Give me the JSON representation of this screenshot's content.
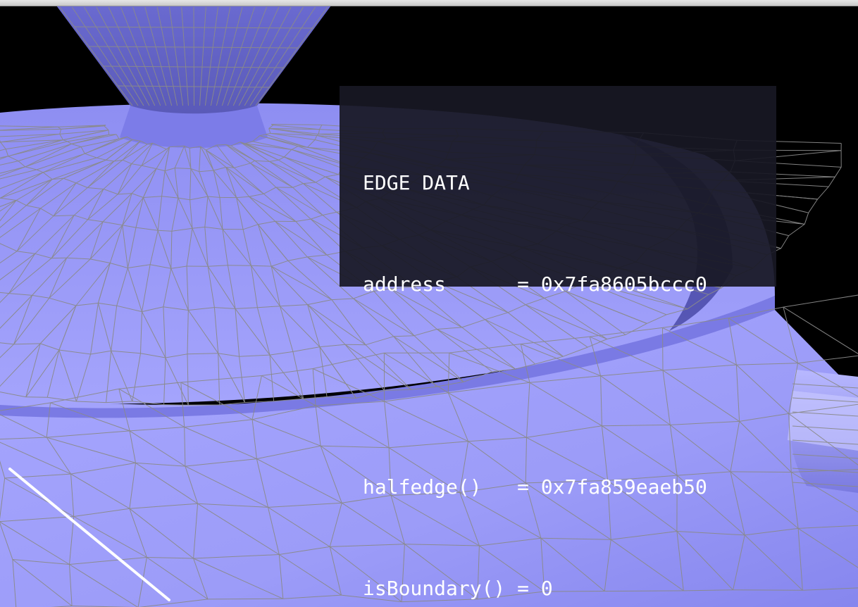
{
  "edge_data_panel": {
    "heading": "EDGE DATA",
    "rows": [
      {
        "label": "address      ",
        "value": "= 0x7fa8605bccc0"
      },
      {
        "label": "",
        "value": ""
      },
      {
        "label": "halfedge()   ",
        "value": "= 0x7fa859eaeb50"
      },
      {
        "label": "isBoundary() ",
        "value": "= 0"
      }
    ]
  },
  "colors": {
    "background": "#000000",
    "mesh_surface": "#9c9cf8",
    "mesh_shadow": "#6e6edc",
    "wireframe_edge": "#8a8a8a",
    "selected_edge": "#ffffff",
    "panel_background": "#181824"
  },
  "icons": {
    "selected_edge": "selected-edge-highlight"
  }
}
